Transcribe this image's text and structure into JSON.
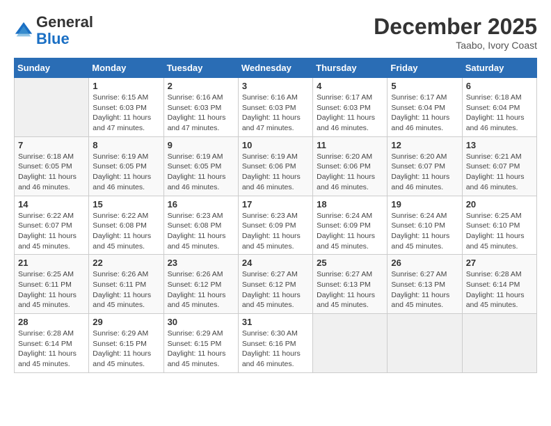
{
  "logo": {
    "general": "General",
    "blue": "Blue"
  },
  "title": "December 2025",
  "location": "Taabo, Ivory Coast",
  "days_of_week": [
    "Sunday",
    "Monday",
    "Tuesday",
    "Wednesday",
    "Thursday",
    "Friday",
    "Saturday"
  ],
  "weeks": [
    [
      {
        "day": "",
        "sunrise": "",
        "sunset": "",
        "daylight": ""
      },
      {
        "day": "1",
        "sunrise": "Sunrise: 6:15 AM",
        "sunset": "Sunset: 6:03 PM",
        "daylight": "Daylight: 11 hours and 47 minutes."
      },
      {
        "day": "2",
        "sunrise": "Sunrise: 6:16 AM",
        "sunset": "Sunset: 6:03 PM",
        "daylight": "Daylight: 11 hours and 47 minutes."
      },
      {
        "day": "3",
        "sunrise": "Sunrise: 6:16 AM",
        "sunset": "Sunset: 6:03 PM",
        "daylight": "Daylight: 11 hours and 47 minutes."
      },
      {
        "day": "4",
        "sunrise": "Sunrise: 6:17 AM",
        "sunset": "Sunset: 6:03 PM",
        "daylight": "Daylight: 11 hours and 46 minutes."
      },
      {
        "day": "5",
        "sunrise": "Sunrise: 6:17 AM",
        "sunset": "Sunset: 6:04 PM",
        "daylight": "Daylight: 11 hours and 46 minutes."
      },
      {
        "day": "6",
        "sunrise": "Sunrise: 6:18 AM",
        "sunset": "Sunset: 6:04 PM",
        "daylight": "Daylight: 11 hours and 46 minutes."
      }
    ],
    [
      {
        "day": "7",
        "sunrise": "Sunrise: 6:18 AM",
        "sunset": "Sunset: 6:05 PM",
        "daylight": "Daylight: 11 hours and 46 minutes."
      },
      {
        "day": "8",
        "sunrise": "Sunrise: 6:19 AM",
        "sunset": "Sunset: 6:05 PM",
        "daylight": "Daylight: 11 hours and 46 minutes."
      },
      {
        "day": "9",
        "sunrise": "Sunrise: 6:19 AM",
        "sunset": "Sunset: 6:05 PM",
        "daylight": "Daylight: 11 hours and 46 minutes."
      },
      {
        "day": "10",
        "sunrise": "Sunrise: 6:19 AM",
        "sunset": "Sunset: 6:06 PM",
        "daylight": "Daylight: 11 hours and 46 minutes."
      },
      {
        "day": "11",
        "sunrise": "Sunrise: 6:20 AM",
        "sunset": "Sunset: 6:06 PM",
        "daylight": "Daylight: 11 hours and 46 minutes."
      },
      {
        "day": "12",
        "sunrise": "Sunrise: 6:20 AM",
        "sunset": "Sunset: 6:07 PM",
        "daylight": "Daylight: 11 hours and 46 minutes."
      },
      {
        "day": "13",
        "sunrise": "Sunrise: 6:21 AM",
        "sunset": "Sunset: 6:07 PM",
        "daylight": "Daylight: 11 hours and 46 minutes."
      }
    ],
    [
      {
        "day": "14",
        "sunrise": "Sunrise: 6:22 AM",
        "sunset": "Sunset: 6:07 PM",
        "daylight": "Daylight: 11 hours and 45 minutes."
      },
      {
        "day": "15",
        "sunrise": "Sunrise: 6:22 AM",
        "sunset": "Sunset: 6:08 PM",
        "daylight": "Daylight: 11 hours and 45 minutes."
      },
      {
        "day": "16",
        "sunrise": "Sunrise: 6:23 AM",
        "sunset": "Sunset: 6:08 PM",
        "daylight": "Daylight: 11 hours and 45 minutes."
      },
      {
        "day": "17",
        "sunrise": "Sunrise: 6:23 AM",
        "sunset": "Sunset: 6:09 PM",
        "daylight": "Daylight: 11 hours and 45 minutes."
      },
      {
        "day": "18",
        "sunrise": "Sunrise: 6:24 AM",
        "sunset": "Sunset: 6:09 PM",
        "daylight": "Daylight: 11 hours and 45 minutes."
      },
      {
        "day": "19",
        "sunrise": "Sunrise: 6:24 AM",
        "sunset": "Sunset: 6:10 PM",
        "daylight": "Daylight: 11 hours and 45 minutes."
      },
      {
        "day": "20",
        "sunrise": "Sunrise: 6:25 AM",
        "sunset": "Sunset: 6:10 PM",
        "daylight": "Daylight: 11 hours and 45 minutes."
      }
    ],
    [
      {
        "day": "21",
        "sunrise": "Sunrise: 6:25 AM",
        "sunset": "Sunset: 6:11 PM",
        "daylight": "Daylight: 11 hours and 45 minutes."
      },
      {
        "day": "22",
        "sunrise": "Sunrise: 6:26 AM",
        "sunset": "Sunset: 6:11 PM",
        "daylight": "Daylight: 11 hours and 45 minutes."
      },
      {
        "day": "23",
        "sunrise": "Sunrise: 6:26 AM",
        "sunset": "Sunset: 6:12 PM",
        "daylight": "Daylight: 11 hours and 45 minutes."
      },
      {
        "day": "24",
        "sunrise": "Sunrise: 6:27 AM",
        "sunset": "Sunset: 6:12 PM",
        "daylight": "Daylight: 11 hours and 45 minutes."
      },
      {
        "day": "25",
        "sunrise": "Sunrise: 6:27 AM",
        "sunset": "Sunset: 6:13 PM",
        "daylight": "Daylight: 11 hours and 45 minutes."
      },
      {
        "day": "26",
        "sunrise": "Sunrise: 6:27 AM",
        "sunset": "Sunset: 6:13 PM",
        "daylight": "Daylight: 11 hours and 45 minutes."
      },
      {
        "day": "27",
        "sunrise": "Sunrise: 6:28 AM",
        "sunset": "Sunset: 6:14 PM",
        "daylight": "Daylight: 11 hours and 45 minutes."
      }
    ],
    [
      {
        "day": "28",
        "sunrise": "Sunrise: 6:28 AM",
        "sunset": "Sunset: 6:14 PM",
        "daylight": "Daylight: 11 hours and 45 minutes."
      },
      {
        "day": "29",
        "sunrise": "Sunrise: 6:29 AM",
        "sunset": "Sunset: 6:15 PM",
        "daylight": "Daylight: 11 hours and 45 minutes."
      },
      {
        "day": "30",
        "sunrise": "Sunrise: 6:29 AM",
        "sunset": "Sunset: 6:15 PM",
        "daylight": "Daylight: 11 hours and 45 minutes."
      },
      {
        "day": "31",
        "sunrise": "Sunrise: 6:30 AM",
        "sunset": "Sunset: 6:16 PM",
        "daylight": "Daylight: 11 hours and 46 minutes."
      },
      {
        "day": "",
        "sunrise": "",
        "sunset": "",
        "daylight": ""
      },
      {
        "day": "",
        "sunrise": "",
        "sunset": "",
        "daylight": ""
      },
      {
        "day": "",
        "sunrise": "",
        "sunset": "",
        "daylight": ""
      }
    ]
  ]
}
